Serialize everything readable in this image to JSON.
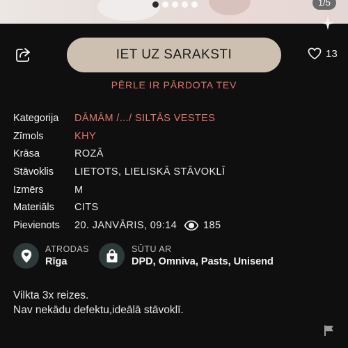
{
  "gallery": {
    "counter": "1/5",
    "total": 5,
    "active_index": 0
  },
  "actions": {
    "cta_label": "IET UZ SARAKSTI",
    "favorites_count": "13"
  },
  "status": {
    "sold_text": "PĒRLE IR PĀRDOTA TEV"
  },
  "attributes": {
    "category_label": "Kategorija",
    "category_value": "DĀMĀM /.../ SILTĀS VESTES",
    "brand_label": "Zīmols",
    "brand_value": "KHY",
    "color_label": "Krāsa",
    "color_value": "ROZĀ",
    "condition_label": "Stāvoklis",
    "condition_value": "LIETOTS, LIELISKĀ STĀVOKLĪ",
    "size_label": "Izmērs",
    "size_value": "M",
    "material_label": "Materiāls",
    "material_value": "CITS",
    "added_label": "Pievienots",
    "added_value": "20. JANVĀRIS, 09:14",
    "views": "185"
  },
  "shipping": {
    "location_label": "ATRODAS",
    "location_value": "Rīga",
    "ships_label": "SŪTU AR",
    "ships_value": "DPD, Omniva, Pasts, Unisend"
  },
  "description": {
    "line1": "Vilkta 3x reizes.",
    "line2": "Nav nekādu defektu,ideālā stāvoklī."
  },
  "colors": {
    "background": "#0f0f0f",
    "accent": "#e2736f",
    "cta_bg": "#cdc0b0",
    "icon_circle": "#2e3a3a"
  },
  "icons": [
    "share-icon",
    "heart-icon",
    "eye-icon",
    "location-pin-icon",
    "shopping-bag-icon",
    "flag-icon",
    "brand-logo-icon"
  ]
}
